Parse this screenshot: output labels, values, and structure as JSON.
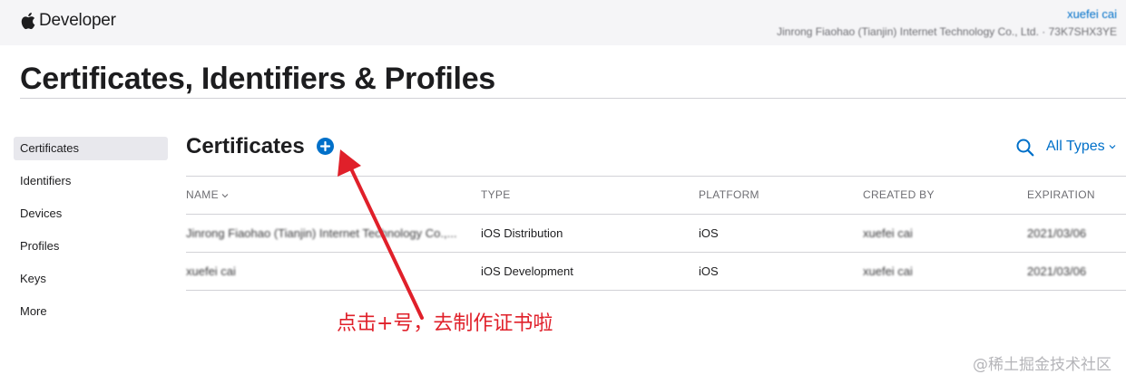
{
  "header": {
    "brand_label": "Developer",
    "brand_icon": "apple-logo-icon",
    "account_name": "xuefei cai",
    "team_info": "Jinrong Fiaohao (Tianjin) Internet Technology Co., Ltd. · 73K7SHX3YE"
  },
  "page": {
    "title": "Certificates, Identifiers & Profiles"
  },
  "sidebar": {
    "items": [
      {
        "label": "Certificates",
        "active": true
      },
      {
        "label": "Identifiers"
      },
      {
        "label": "Devices"
      },
      {
        "label": "Profiles"
      },
      {
        "label": "Keys"
      },
      {
        "label": "More"
      }
    ]
  },
  "section": {
    "title": "Certificates",
    "add_icon": "plus-circle-icon",
    "search_icon": "search-icon",
    "filter_label": "All Types"
  },
  "table": {
    "columns": {
      "name": "NAME",
      "type": "TYPE",
      "platform": "PLATFORM",
      "created_by": "CREATED BY",
      "expiration": "EXPIRATION"
    },
    "rows": [
      {
        "name": "Jinrong Fiaohao (Tianjin) Internet Technology Co.,...",
        "type": "iOS Distribution",
        "platform": "iOS",
        "created_by": "xuefei cai",
        "expiration": "2021/03/06"
      },
      {
        "name": "xuefei cai",
        "type": "iOS Development",
        "platform": "iOS",
        "created_by": "xuefei cai",
        "expiration": "2021/03/06"
      }
    ]
  },
  "annotation": {
    "text": "点击+号，去制作证书啦",
    "color": "#e0202a"
  },
  "watermark": {
    "text": "@稀土掘金技术社区"
  },
  "colors": {
    "accent": "#0070c9",
    "topbar_bg": "#f5f5f7",
    "sidebar_active_bg": "#e8e8ed"
  }
}
